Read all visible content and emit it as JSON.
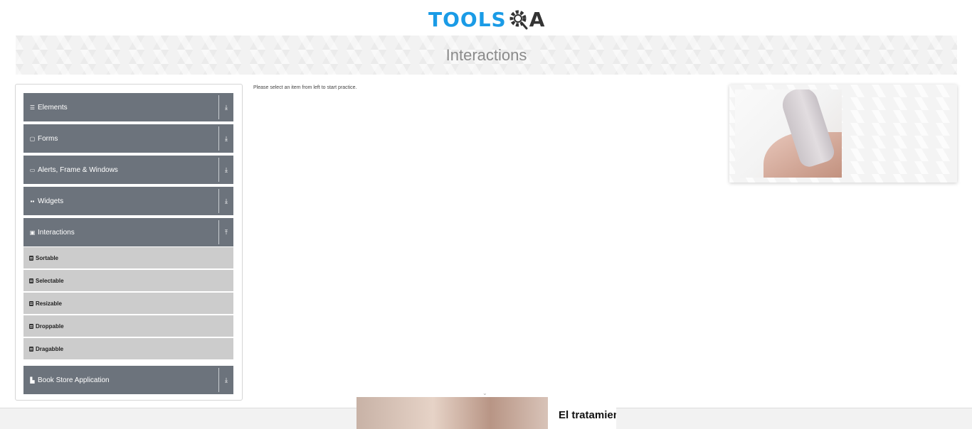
{
  "header": {
    "logo_left": "TOOLS",
    "logo_right": "A"
  },
  "banner": {
    "title": "Interactions"
  },
  "sidebar": {
    "groups": [
      {
        "label": "Elements",
        "icon": "menu-icon",
        "toggle": "⤓"
      },
      {
        "label": "Forms",
        "icon": "form-icon",
        "toggle": "⤓"
      },
      {
        "label": "Alerts, Frame & Windows",
        "icon": "window-icon",
        "toggle": "⤓"
      },
      {
        "label": "Widgets",
        "icon": "grid-icon",
        "toggle": "⤓"
      },
      {
        "label": "Interactions",
        "icon": "interactions-icon",
        "toggle": "⤒"
      },
      {
        "label": "Book Store Application",
        "icon": "book-icon",
        "toggle": "⤓"
      }
    ],
    "interactions_items": [
      "Sortable",
      "Selectable",
      "Resizable",
      "Droppable",
      "Dragabble"
    ]
  },
  "main": {
    "hint": "Please select an item from left to start practice."
  },
  "bottom_ad": {
    "text": "El tratamiento lo que cre"
  },
  "colors": {
    "accent": "#1a9be6",
    "group_bg": "#6c737c",
    "sub_bg": "#cccccc"
  }
}
